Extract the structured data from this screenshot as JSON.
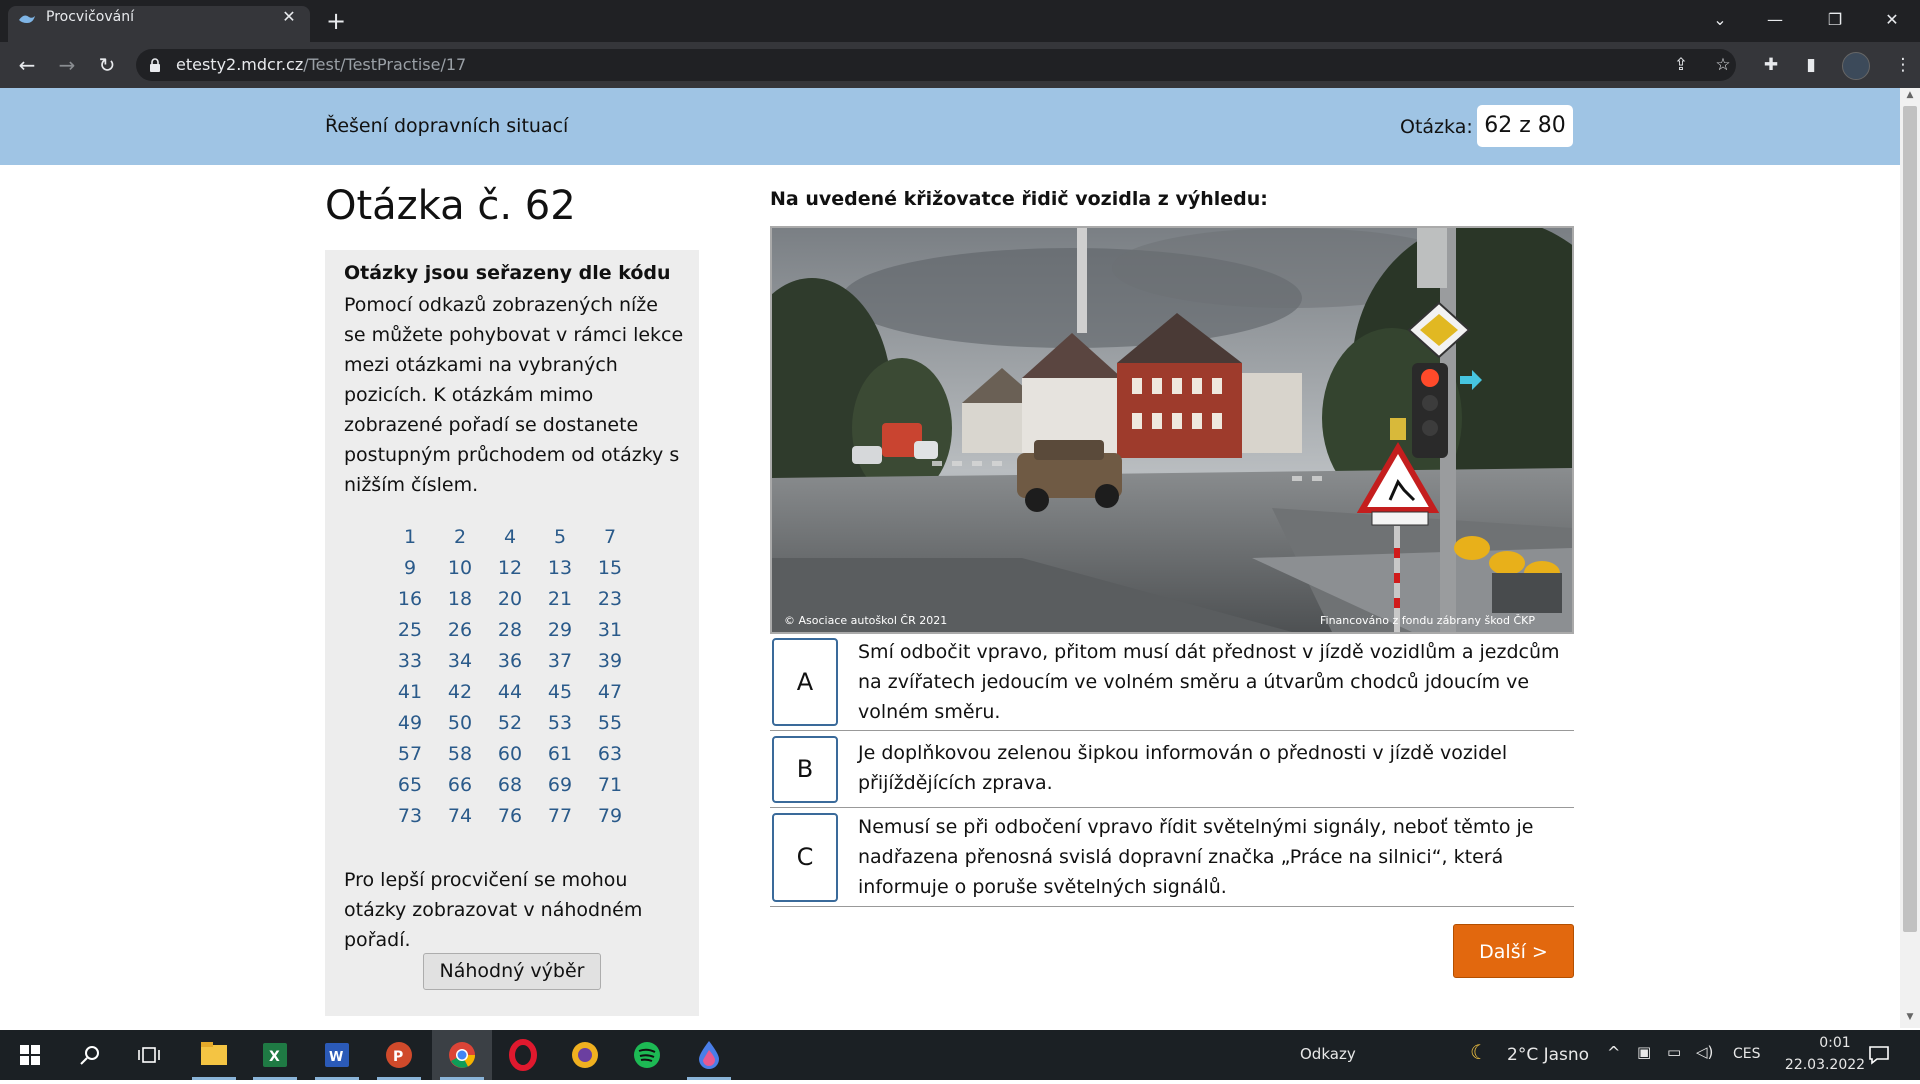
{
  "browser": {
    "tab_title": "Procvičování",
    "url_host": "etesty2.mdcr.cz",
    "url_path": "/Test/TestPractise/17"
  },
  "header": {
    "section_title": "Řešení dopravních situací",
    "counter_label": "Otázka:",
    "counter_value": "62 z 80"
  },
  "question": {
    "heading": "Otázka č. 62",
    "text": "Na uvedené křižovatce řidič vozidla z výhledu:",
    "image_caption_left": "© Asociace autoškol ČR 2021",
    "image_caption_right": "Financováno z fondu zábrany škod ČKP"
  },
  "sidebar": {
    "title": "Otázky jsou seřazeny dle kódu",
    "text": "Pomocí odkazů zobrazených níže se můžete pohybovat v rámci lekce mezi otázkami na vybraných pozicích. K otázkám mimo zobrazené pořadí se dostanete postupným průchodem od otázky s nižším číslem.",
    "question_links": [
      "1",
      "2",
      "4",
      "5",
      "7",
      "9",
      "10",
      "12",
      "13",
      "15",
      "16",
      "18",
      "20",
      "21",
      "23",
      "25",
      "26",
      "28",
      "29",
      "31",
      "33",
      "34",
      "36",
      "37",
      "39",
      "41",
      "42",
      "44",
      "45",
      "47",
      "49",
      "50",
      "52",
      "53",
      "55",
      "57",
      "58",
      "60",
      "61",
      "63",
      "65",
      "66",
      "68",
      "69",
      "71",
      "73",
      "74",
      "76",
      "77",
      "79"
    ],
    "random_text": "Pro lepší procvičení se mohou otázky zobrazovat v náhodném pořadí.",
    "random_button": "Náhodný výběr"
  },
  "answers": [
    {
      "letter": "A",
      "text": "Smí odbočit vpravo, přitom musí dát přednost v jízdě vozidlům a jezdcům na zvířatech jedoucím ve volném směru a útvarům chodců jdoucím ve volném směru."
    },
    {
      "letter": "B",
      "text": "Je doplňkovou zelenou šipkou informován o přednosti v jízdě vozidel přijíždějících zprava."
    },
    {
      "letter": "C",
      "text": "Nemusí se při odbočení vpravo řídit světelnými signály, neboť těmto je nadřazena přenosná svislá dopravní značka „Práce na silnici“, která informuje o poruše světelných signálů."
    }
  ],
  "next_button": "Další >",
  "taskbar": {
    "links_label": "Odkazy",
    "weather": "2°C  Jasno",
    "language": "CES",
    "time": "0:01",
    "date": "22.03.2022"
  },
  "icons": [
    "windows-start-icon",
    "search-icon",
    "task-view-icon",
    "file-explorer-icon",
    "excel-icon",
    "word-icon",
    "powerpoint-icon",
    "chrome-icon",
    "opera-icon",
    "brave-icon",
    "spotify-icon",
    "drop-app-icon"
  ],
  "colors": {
    "header_bg": "#9fc4e4",
    "next_button": "#e2680e",
    "link": "#2a5a8a",
    "answer_border": "#3a6a9a"
  }
}
